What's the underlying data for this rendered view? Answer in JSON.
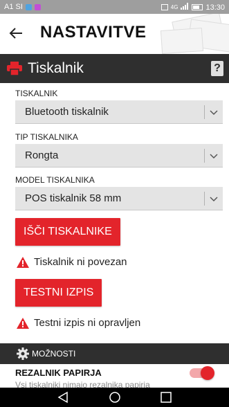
{
  "status_bar": {
    "carrier": "A1 SI",
    "signal_badge": "4G",
    "time": "13:30"
  },
  "app_bar": {
    "back_icon": "arrow-left-icon",
    "title": "NASTAVITVE"
  },
  "section": {
    "icon": "printer-icon",
    "title": "Tiskalnik",
    "help_label": "?"
  },
  "fields": [
    {
      "label": "TISKALNIK",
      "value": "Bluetooth tiskalnik"
    },
    {
      "label": "TIP TISKALNIKA",
      "value": "Rongta"
    },
    {
      "label": "MODEL TISKALNIKA",
      "value": "POS tiskalnik 58 mm"
    }
  ],
  "actions": {
    "search_label": "IŠČI TISKALNIKE",
    "search_status": "Tiskalnik ni povezan",
    "test_label": "TESTNI IZPIS",
    "test_status": "Testni izpis ni opravljen"
  },
  "options": {
    "icon": "gear-icon",
    "title": "MOŽNOSTI",
    "cutter_title": "REZALNIK PAPIRJA",
    "cutter_subtitle": "Vsi tiskalniki nimajo rezalnika papirja",
    "cutter_enabled": true
  },
  "colors": {
    "accent": "#e3242b",
    "section_bg": "#2f2f2f",
    "status_bar": "#9e9e9e",
    "select_bg": "#e4e4e4"
  }
}
